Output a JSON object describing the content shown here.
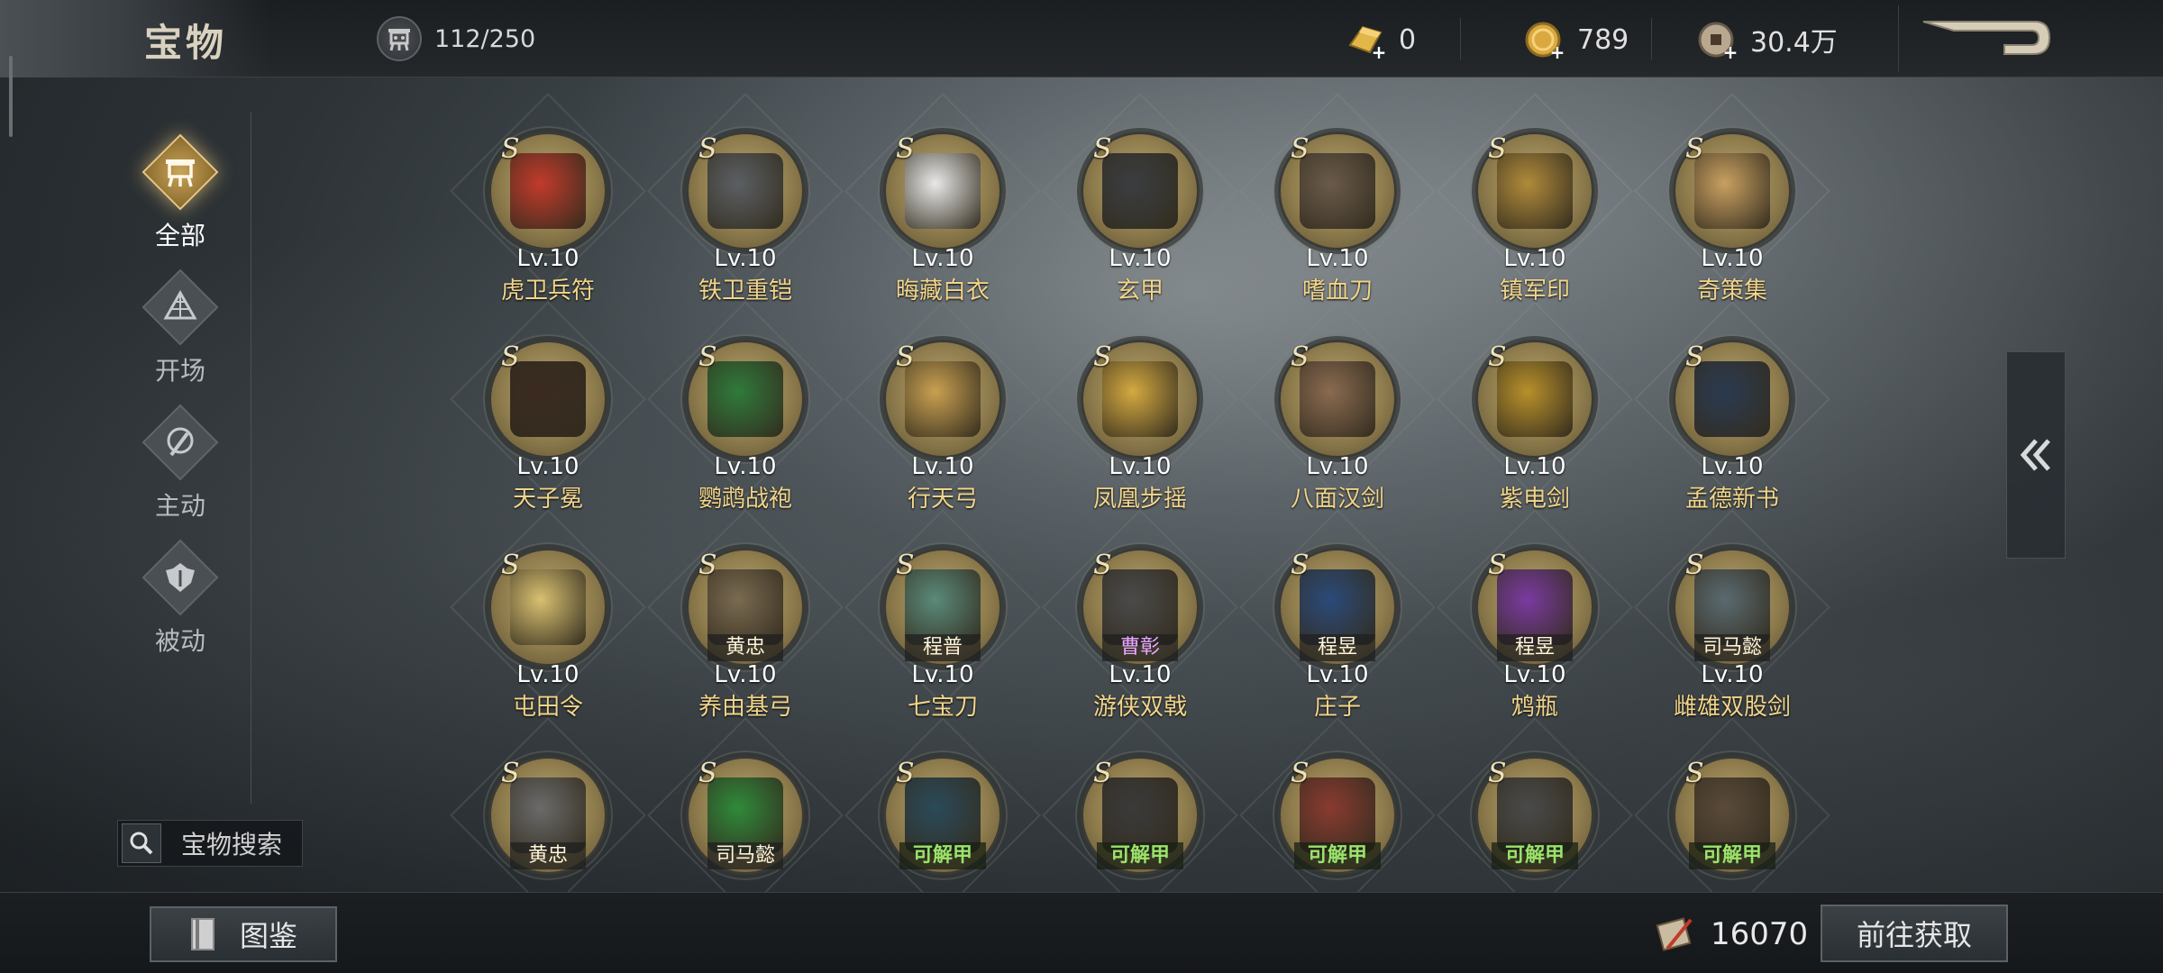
{
  "header": {
    "title": "宝物",
    "capacity": "112/250",
    "currencies": [
      {
        "icon": "gold-bar-icon",
        "value": "0"
      },
      {
        "icon": "gold-coin-icon",
        "value": "789"
      },
      {
        "icon": "copper-coin-icon",
        "value": "30.4万"
      }
    ],
    "back_icon": "back-arrow-icon"
  },
  "sidebar": {
    "items": [
      {
        "label": "全部",
        "icon": "tripod-icon",
        "active": true
      },
      {
        "label": "开场",
        "icon": "pyramid-icon",
        "active": false
      },
      {
        "label": "主动",
        "icon": "axe-icon",
        "active": false
      },
      {
        "label": "被动",
        "icon": "armor-icon",
        "active": false
      }
    ],
    "search_label": "宝物搜索"
  },
  "rank_mark": "S",
  "treasures": [
    {
      "name": "虎卫兵符",
      "level": "Lv.10",
      "color": "#c23a2a"
    },
    {
      "name": "铁卫重铠",
      "level": "Lv.10",
      "color": "#5b5f63"
    },
    {
      "name": "晦藏白衣",
      "level": "Lv.10",
      "color": "#e8e8e8"
    },
    {
      "name": "玄甲",
      "level": "Lv.10",
      "color": "#3a3d40"
    },
    {
      "name": "嗜血刀",
      "level": "Lv.10",
      "color": "#6a5a4a"
    },
    {
      "name": "镇军印",
      "level": "Lv.10",
      "color": "#b08a3a"
    },
    {
      "name": "奇策集",
      "level": "Lv.10",
      "color": "#c9a060"
    },
    {
      "name": "天子冕",
      "level": "Lv.10",
      "color": "#3a2a20"
    },
    {
      "name": "鹦鹉战袍",
      "level": "Lv.10",
      "color": "#2f7a3a"
    },
    {
      "name": "行天弓",
      "level": "Lv.10",
      "color": "#c9a050"
    },
    {
      "name": "凤凰步摇",
      "level": "Lv.10",
      "color": "#d4a940"
    },
    {
      "name": "八面汉剑",
      "level": "Lv.10",
      "color": "#8a6a50"
    },
    {
      "name": "紫电剑",
      "level": "Lv.10",
      "color": "#b8902a"
    },
    {
      "name": "孟德新书",
      "level": "Lv.10",
      "color": "#2a3a50"
    },
    {
      "name": "屯田令",
      "level": "Lv.10",
      "color": "#d8c070",
      "hero": ""
    },
    {
      "name": "养由基弓",
      "level": "Lv.10",
      "color": "#7a6a50",
      "hero": "黄忠"
    },
    {
      "name": "七宝刀",
      "level": "Lv.10",
      "color": "#5a8a7a",
      "hero": "程普"
    },
    {
      "name": "游侠双戟",
      "level": "Lv.10",
      "color": "#4a4a4a",
      "hero": "曹彰",
      "hero_purple": true
    },
    {
      "name": "庄子",
      "level": "Lv.10",
      "color": "#2a4a7a",
      "hero": "程昱"
    },
    {
      "name": "鸩瓶",
      "level": "Lv.10",
      "color": "#7a3aa0",
      "hero": "程昱"
    },
    {
      "name": "雌雄双股剑",
      "level": "Lv.10",
      "color": "#5a6a70",
      "hero": "司马懿"
    },
    {
      "name": "",
      "level": "",
      "color": "#6a6a6a",
      "hero": "黄忠"
    },
    {
      "name": "",
      "level": "",
      "color": "#2f8a3a",
      "hero": "司马懿"
    },
    {
      "name": "",
      "level": "",
      "color": "#2a4a5a",
      "unlock": "可解甲"
    },
    {
      "name": "",
      "level": "",
      "color": "#3a3a3a",
      "unlock": "可解甲"
    },
    {
      "name": "",
      "level": "",
      "color": "#8a3a30",
      "unlock": "可解甲"
    },
    {
      "name": "",
      "level": "",
      "color": "#4a4a4a",
      "unlock": "可解甲"
    },
    {
      "name": "",
      "level": "",
      "color": "#5a4a3a",
      "unlock": "可解甲"
    }
  ],
  "footer": {
    "codex_label": "图鉴",
    "token_value": "16070",
    "goto_label": "前往获取"
  },
  "colors": {
    "name_gold": "#f2d58a",
    "unlock_green": "#9be36b",
    "hero_purple": "#e9a6ff"
  }
}
